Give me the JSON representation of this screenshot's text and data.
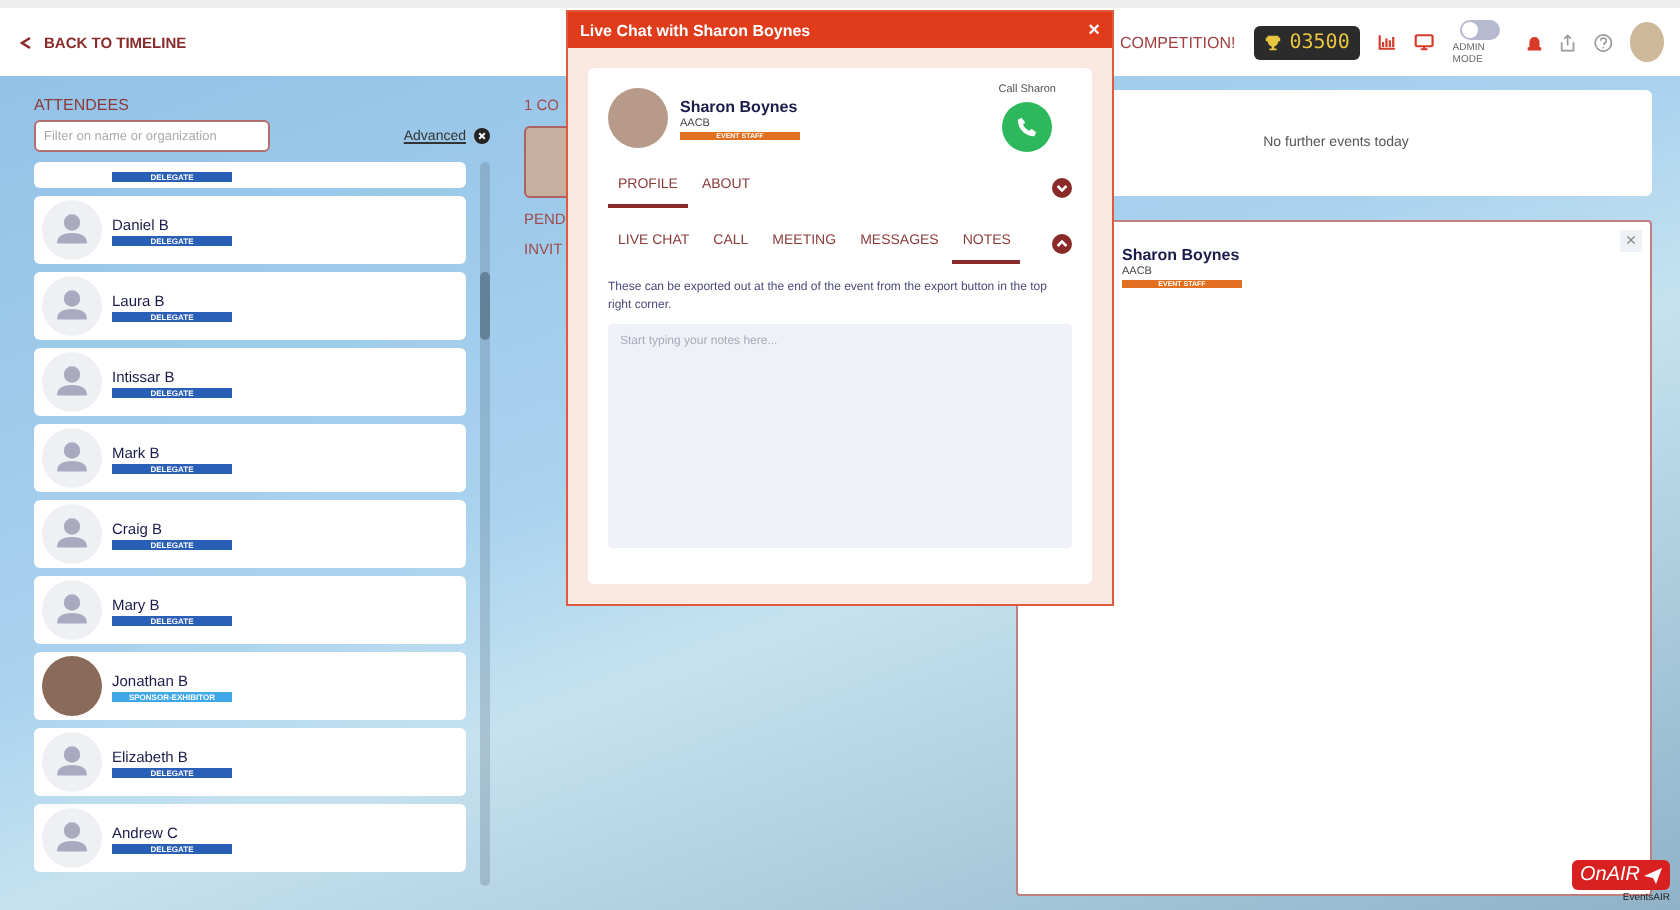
{
  "top_bar": {
    "back_link": "BACK TO TIMELINE",
    "competition": "COMPETITION!",
    "score": "03500",
    "admin_mode": {
      "label": "ADMIN MODE",
      "on": false
    }
  },
  "attendees": {
    "title": "ATTENDEES",
    "filter_placeholder": "Filter on name or organization",
    "advanced_link": "Advanced",
    "items": [
      {
        "badge": "DELEGATE",
        "color": "#2a5fb8",
        "photo": false
      },
      {
        "name": "Daniel B",
        "badge": "DELEGATE",
        "color": "#2a5fb8",
        "photo": false
      },
      {
        "name": "Laura B",
        "badge": "DELEGATE",
        "color": "#2a5fb8",
        "photo": false
      },
      {
        "name": "Intissar B",
        "badge": "DELEGATE",
        "color": "#2a5fb8",
        "photo": false
      },
      {
        "name": "Mark B",
        "badge": "DELEGATE",
        "color": "#2a5fb8",
        "photo": false
      },
      {
        "name": "Craig B",
        "badge": "DELEGATE",
        "color": "#2a5fb8",
        "photo": false
      },
      {
        "name": "Mary B",
        "badge": "DELEGATE",
        "color": "#2a5fb8",
        "photo": false
      },
      {
        "name": "Jonathan B",
        "badge": "SPONSOR-EXHIBITOR",
        "color": "#3fa9e8",
        "photo": true
      },
      {
        "name": "Elizabeth B",
        "badge": "DELEGATE",
        "color": "#2a5fb8",
        "photo": false
      },
      {
        "name": "Andrew C",
        "badge": "DELEGATE",
        "color": "#2a5fb8",
        "photo": false
      }
    ]
  },
  "connections": {
    "heading": "1 CO",
    "pending": "PEND",
    "invites": "INVIT"
  },
  "chat_modal": {
    "title": "Live Chat with Sharon Boynes",
    "close": "×",
    "profile": {
      "name": "Sharon Boynes",
      "organization": "AACB",
      "badge": "EVENT STAFF"
    },
    "call_label": "Call Sharon",
    "sections": [
      {
        "expanded": false,
        "tabs": [
          {
            "label": "PROFILE",
            "selected": true
          },
          {
            "label": "ABOUT",
            "selected": false
          }
        ]
      },
      {
        "expanded": true,
        "tabs": [
          {
            "label": "LIVE CHAT",
            "selected": false
          },
          {
            "label": "CALL",
            "selected": false
          },
          {
            "label": "MEETING",
            "selected": false
          },
          {
            "label": "MESSAGES",
            "selected": false
          },
          {
            "label": "NOTES",
            "selected": true
          }
        ]
      }
    ],
    "notes_hint": "These can be exported out at the end of the event from the export button in the top right corner.",
    "notes_placeholder": "Start typing your notes here..."
  },
  "events": {
    "message": "No further events today"
  },
  "profile_card": {
    "name": "Sharon Boynes",
    "organization": "AACB",
    "badge": "EVENT STAFF",
    "close": "×"
  },
  "footer": {
    "logo": "OnAIR",
    "byline": "EventsAIR"
  }
}
